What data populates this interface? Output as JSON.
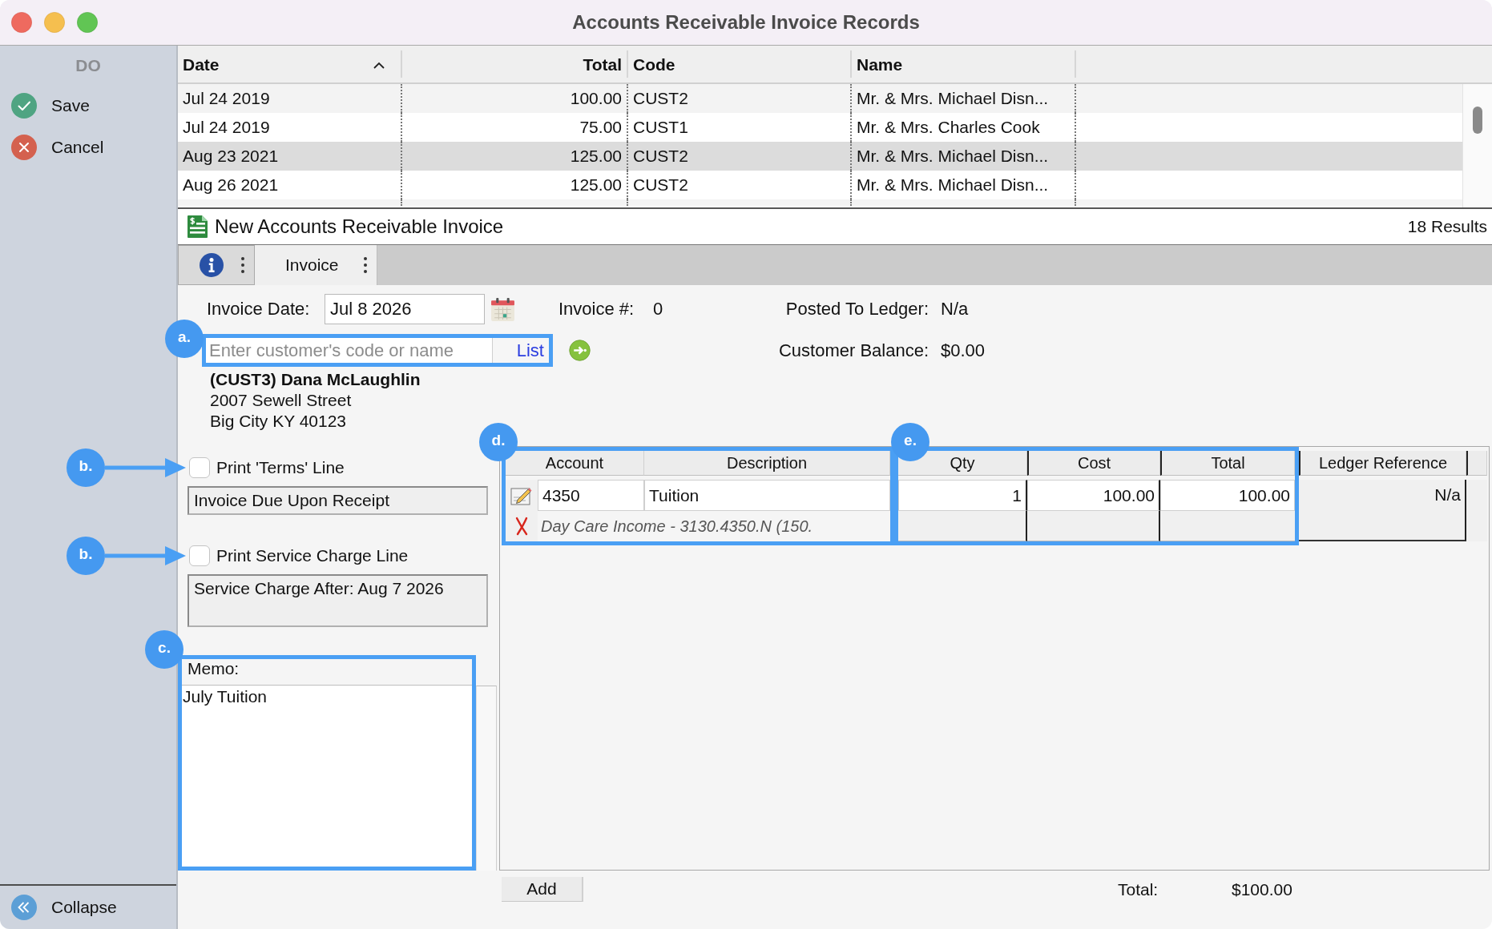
{
  "window": {
    "title": "Accounts Receivable Invoice Records"
  },
  "sidebar": {
    "heading": "DO",
    "actions": [
      {
        "kind": "save",
        "label": "Save"
      },
      {
        "kind": "cancel",
        "label": "Cancel"
      }
    ],
    "collapse": {
      "label": "Collapse"
    }
  },
  "records_table": {
    "columns": [
      {
        "label": "Date",
        "kind": "text",
        "sorted": true
      },
      {
        "label": "Total",
        "kind": "number",
        "sorted": false
      },
      {
        "label": "Code",
        "kind": "text",
        "sorted": false
      },
      {
        "label": "Name",
        "kind": "text",
        "sorted": false
      }
    ],
    "rows": [
      {
        "cells": [
          "Jul 24 2019",
          "100.00",
          "CUST2",
          "Mr. & Mrs. Michael Disn..."
        ],
        "selected": false
      },
      {
        "cells": [
          "Jul 24 2019",
          "75.00",
          "CUST1",
          "Mr. & Mrs. Charles Cook"
        ],
        "selected": false
      },
      {
        "cells": [
          "Aug 23 2021",
          "125.00",
          "CUST2",
          "Mr. & Mrs. Michael Disn..."
        ],
        "selected": true
      },
      {
        "cells": [
          "Aug 26 2021",
          "125.00",
          "CUST2",
          "Mr. & Mrs. Michael Disn..."
        ],
        "selected": false
      }
    ]
  },
  "invoice_panel": {
    "title": "New Accounts Receivable Invoice",
    "result_count": "18 Results",
    "tabs": [
      {
        "kind": "info",
        "selected": false
      },
      {
        "kind": "label",
        "label": "Invoice",
        "selected": true
      }
    ]
  },
  "form": {
    "invoice_date": {
      "label": "Invoice Date:",
      "value": "Jul 8 2026"
    },
    "invoice_number": {
      "label": "Invoice #:",
      "value": "0"
    },
    "posted_to_ledger": {
      "label": "Posted To Ledger:",
      "value": "N/a"
    },
    "customer_search": {
      "placeholder": "Enter customer's code or name",
      "button": "List",
      "callout": "a."
    },
    "customer_balance": {
      "label": "Customer Balance:",
      "value": "$0.00"
    },
    "customer": {
      "name": "(CUST3) Dana McLaughlin",
      "address_lines": [
        "2007 Sewell Street",
        "Big City KY 40123"
      ]
    },
    "print_options": [
      {
        "label": "Print 'Terms' Line",
        "checked": false,
        "text": "Invoice Due Upon Receipt",
        "callout": "b."
      },
      {
        "label": "Print Service Charge Line",
        "checked": false,
        "text": "Service Charge After: Aug 7 2026",
        "callout": "b."
      }
    ],
    "memo": {
      "label": "Memo:",
      "value": "July Tuition",
      "callout": "c."
    }
  },
  "line_items": {
    "columns": [
      "Account",
      "Description",
      "Qty",
      "Cost",
      "Total",
      "Ledger Reference"
    ],
    "callouts": [
      "d.",
      "e."
    ],
    "rows": [
      {
        "account": "4350",
        "description": "Tuition",
        "qty": "1",
        "cost": "100.00",
        "total": "100.00",
        "ledger_reference": "N/a",
        "detail": "Day Care Income - 3130.4350.N (150."
      }
    ],
    "add_button": "Add",
    "total_label": "Total:",
    "total_value": "$100.00"
  }
}
